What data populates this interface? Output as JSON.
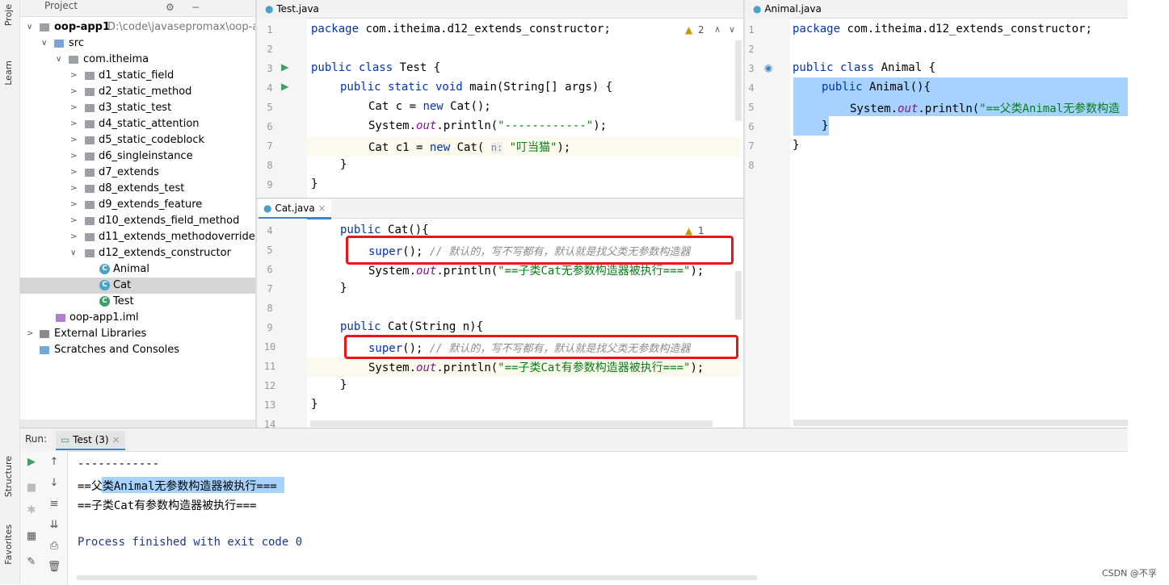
{
  "left_strip": {
    "project_label": "Proje",
    "learn_label": "Learn",
    "structure_label": "Structure",
    "favorites_label": "Favorites"
  },
  "project": {
    "header": "Project",
    "root_name": "oop-app1",
    "root_path": "D:\\code\\javasepromax\\oop-ap",
    "src": "src",
    "package": "com.itheima",
    "folders": [
      "d1_static_field",
      "d2_static_method",
      "d3_static_test",
      "d4_static_attention",
      "d5_static_codeblock",
      "d6_singleinstance",
      "d7_extends",
      "d8_extends_test",
      "d9_extends_feature",
      "d10_extends_field_method",
      "d11_extends_methodoverride",
      "d12_extends_constructor"
    ],
    "classes": [
      "Animal",
      "Cat",
      "Test"
    ],
    "iml": "oop-app1.iml",
    "external": "External Libraries",
    "scratches": "Scratches and Consoles"
  },
  "editor_test": {
    "tab": "Test.java",
    "warnings": "2",
    "lines": [
      "1",
      "2",
      "3",
      "4",
      "5",
      "6",
      "7",
      "8",
      "9"
    ],
    "code": {
      "l1_kw": "package ",
      "l1_rest": "com.itheima.d12_extends_constructor;",
      "l3_kw": "public class ",
      "l3_rest": "Test {",
      "l4_kw": "public static void ",
      "l4_rest": "main(String[] args) {",
      "l5_a": "Cat c = ",
      "l5_kw": "new ",
      "l5_b": "Cat();",
      "l6_a": "System.",
      "l6_it": "out",
      "l6_b": ".println(",
      "l6_str": "\"------------\"",
      "l6_c": ");",
      "l7_a": "Cat c1 = ",
      "l7_kw": "new ",
      "l7_b": "Cat( ",
      "l7_hint": "n:",
      "l7_str": " \"叮当猫\"",
      "l7_c": ");",
      "l8": "}",
      "l9": "}"
    }
  },
  "editor_cat": {
    "tab": "Cat.java",
    "warnings": "1",
    "lines": [
      "4",
      "5",
      "6",
      "7",
      "8",
      "9",
      "10",
      "11",
      "12",
      "13",
      "14"
    ],
    "code": {
      "l4_kw": "public ",
      "l4_rest": "Cat(){",
      "l5_kw": "super",
      "l5_rest": "(); ",
      "l5_cm": "// 默认的，写不写都有，默认就是找父类无参数构造器",
      "l6_a": "System.",
      "l6_it": "out",
      "l6_b": ".println(",
      "l6_str": "\"==子类Cat无参数构造器被执行===\"",
      "l6_c": ");",
      "l7": "}",
      "l9_kw": "public ",
      "l9_rest": "Cat(String n){",
      "l10_kw": "super",
      "l10_rest": "(); ",
      "l10_cm": "// 默认的，写不写都有，默认就是找父类无参数构造器",
      "l11_a": "System.",
      "l11_it": "out",
      "l11_b": ".println(",
      "l11_str": "\"==子类Cat有参数构造器被执行===\"",
      "l11_c": ");",
      "l12": "}",
      "l13": "}"
    }
  },
  "editor_animal": {
    "tab": "Animal.java",
    "lines": [
      "1",
      "2",
      "3",
      "4",
      "5",
      "6",
      "7",
      "8"
    ],
    "code": {
      "l1_kw": "package ",
      "l1_rest": "com.itheima.d12_extends_constructor;",
      "l3_kw": "public class ",
      "l3_rest": "Animal {",
      "l4_kw": "public ",
      "l4_rest": "Animal(){",
      "l5_a": "System.",
      "l5_it": "out",
      "l5_b": ".println(",
      "l5_str": "\"==父类Animal无参数构造",
      "l6": "}",
      "l7": "}"
    }
  },
  "run": {
    "label": "Run:",
    "tab": "Test (3)",
    "output": [
      "------------",
      "==父类Animal无参数构造器被执行===",
      "==子类Cat有参数构造器被执行===",
      "Process finished with exit code 0"
    ]
  },
  "watermark": "CSDN @不孚",
  "colors": {
    "keyword": "#0033b3",
    "string": "#067d17",
    "comment": "#8c8c8c",
    "field": "#871094",
    "selection": "#a6d2ff",
    "redbox": "#e8161b"
  }
}
